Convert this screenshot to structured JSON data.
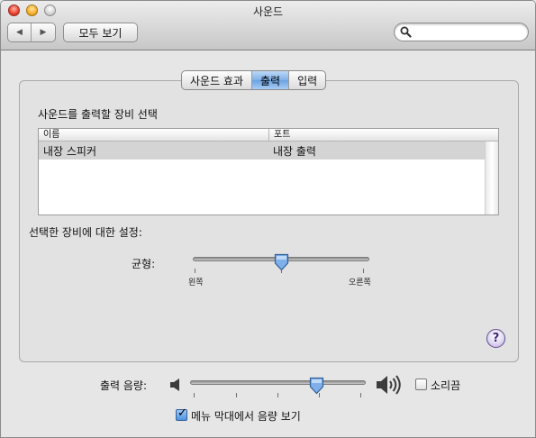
{
  "window": {
    "title": "사운드"
  },
  "toolbar": {
    "show_all_label": "모두 보기",
    "back_icon": "◀",
    "forward_icon": "▶",
    "search": {
      "value": "",
      "placeholder": ""
    }
  },
  "tabs": [
    {
      "label": "사운드 효과",
      "selected": false
    },
    {
      "label": "출력",
      "selected": true
    },
    {
      "label": "입력",
      "selected": false
    }
  ],
  "output": {
    "choose_device_label": "사운드를 출력할 장비 선택",
    "columns": [
      "이름",
      "포트"
    ],
    "devices": [
      {
        "name": "내장 스피커",
        "port": "내장 출력",
        "selected": true
      }
    ],
    "settings_label": "선택한 장비에 대한 설정:",
    "balance": {
      "label": "균형:",
      "left_label": "왼쪽",
      "right_label": "오른쪽",
      "value": 0.5
    }
  },
  "help_label": "?",
  "volume": {
    "label": "출력 음량:",
    "value": 0.73,
    "mute_label": "소리끔",
    "mute_checked": false,
    "show_in_menubar_label": "메뉴 막대에서 음량 보기",
    "show_in_menubar_checked": true
  },
  "colors": {
    "selection": "#d4d4d4",
    "accent": "#6aa2e2"
  }
}
